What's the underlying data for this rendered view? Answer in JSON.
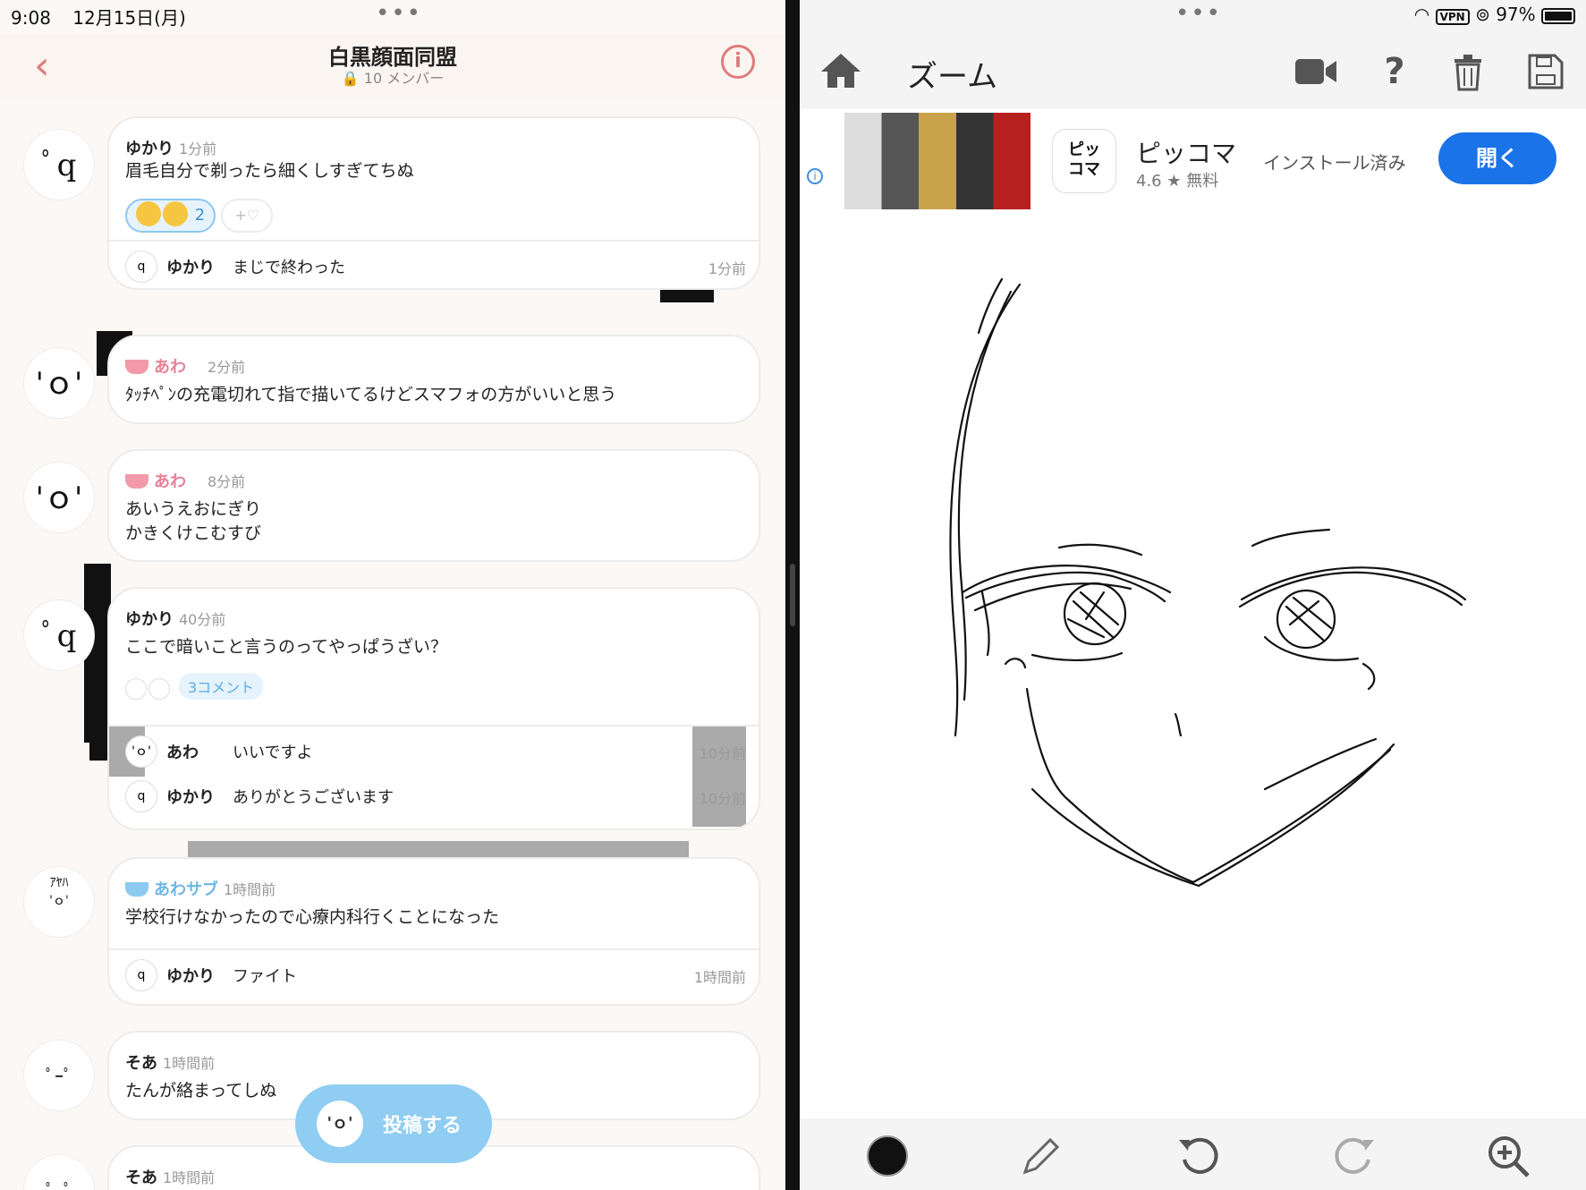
{
  "status": {
    "time": "9:08",
    "date": "12月15日(月)",
    "vpn": "VPN",
    "battery": "97%"
  },
  "left_app": {
    "title": "白黒顔面同盟",
    "members": "10 メンバー",
    "post_button": "投稿する",
    "posts": [
      {
        "name": "ゆかり",
        "time": "1分前",
        "text": "眉毛自分で剃ったら細くしすぎてちぬ",
        "reaction_count": "2",
        "add_reaction": "+♡",
        "replies": [
          {
            "name": "ゆかり",
            "text": "まじで終わった",
            "time": "1分前"
          }
        ]
      },
      {
        "name": "あわ",
        "time": "2分前",
        "text": "ﾀｯﾁﾍﾟﾝの充電切れて指で描いてるけどスマフォの方がいいと思う"
      },
      {
        "name": "あわ",
        "time": "8分前",
        "text": "あいうえおにぎり",
        "text2": "かきくけこむすび"
      },
      {
        "name": "ゆかり",
        "time": "40分前",
        "text": "ここで暗いこと言うのってやっぱうざい？",
        "comments": "3コメント",
        "replies": [
          {
            "name": "あわ",
            "text": "いいですよ",
            "time": "10分前"
          },
          {
            "name": "ゆかり",
            "text": "ありがとうございます",
            "time": "10分前"
          }
        ]
      },
      {
        "name": "あわサブ",
        "time": "1時間前",
        "text": "学校行けなかったので心療内科行くことになった",
        "replies": [
          {
            "name": "ゆかり",
            "text": "ファイト",
            "time": "1時間前"
          }
        ]
      },
      {
        "name": "そあ",
        "time": "1時間前",
        "text": "たんが絡まってしぬ"
      },
      {
        "name": "そあ",
        "time": "1時間前"
      }
    ]
  },
  "right_app": {
    "title": "ズーム",
    "ad": {
      "app_name": "ピッコマ",
      "rating": "4.6 ★ 無料",
      "installed": "インストール済み",
      "open_button": "開く",
      "icon_line1": "ピッ",
      "icon_line2": "コマ"
    },
    "tools": [
      "home-icon",
      "video-camera-icon",
      "help-icon",
      "trash-icon",
      "save-icon"
    ],
    "bottom_tools": [
      "brush-color-black",
      "pencil-icon",
      "undo-icon",
      "redo-icon",
      "zoom-in-icon"
    ],
    "colors": {
      "accent": "#1a73e8",
      "brush": "#111111"
    }
  },
  "colors": {
    "accent_pink": "#e07a7a",
    "name_pink": "#e77f95",
    "name_blue": "#6db7e6",
    "post_button": "#8fcdf2"
  }
}
